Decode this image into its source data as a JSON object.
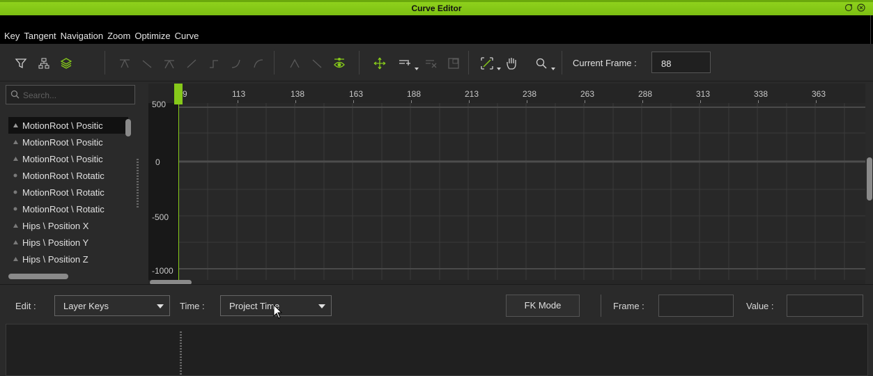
{
  "window": {
    "title": "Curve Editor",
    "restore_icon": "restore-icon",
    "close_icon": "close-icon"
  },
  "menu": [
    "Key",
    "Tangent",
    "Navigation",
    "Zoom",
    "Optimize",
    "Curve"
  ],
  "toolbar": {
    "current_frame_label": "Current Frame :",
    "current_frame_value": "88",
    "icons": [
      "filter-curve-icon",
      "hierarchy-icon",
      "layers-icon",
      "flatten-tangent-icon",
      "linear-tangent-icon",
      "smooth-tangent-icon",
      "step-tangent-icon",
      "step-out-icon",
      "ease-in-icon",
      "ease-out-icon",
      "break-tangent-icon",
      "unify-tangent-icon",
      "show-tangents-icon",
      "move-icon",
      "add-key-icon",
      "delete-key-icon",
      "fit-icon",
      "zoom-extent-icon",
      "pan-hand-icon",
      "zoom-icon"
    ],
    "accent": "#86c91a"
  },
  "search": {
    "placeholder": "Search..."
  },
  "curve_list": [
    {
      "label": "MotionRoot \\ Positic",
      "marker": "triangle",
      "selected": true
    },
    {
      "label": "MotionRoot \\ Positic",
      "marker": "triangle"
    },
    {
      "label": "MotionRoot \\ Positic",
      "marker": "triangle"
    },
    {
      "label": "MotionRoot \\ Rotatic",
      "marker": "dot"
    },
    {
      "label": "MotionRoot \\ Rotatic",
      "marker": "dot"
    },
    {
      "label": "MotionRoot \\ Rotatic",
      "marker": "dot"
    },
    {
      "label": "Hips \\ Position X",
      "marker": "triangle"
    },
    {
      "label": "Hips \\ Position Y",
      "marker": "triangle"
    },
    {
      "label": "Hips \\ Position Z",
      "marker": "triangle"
    }
  ],
  "graph": {
    "time_ticks": [
      "9",
      "113",
      "138",
      "163",
      "188",
      "213",
      "238",
      "263",
      "288",
      "313",
      "338",
      "363"
    ],
    "value_ticks": [
      "500",
      "0",
      "-500",
      "-1000"
    ],
    "current_frame_marker": "88"
  },
  "bottom": {
    "edit_label": "Edit :",
    "edit_value": "Layer Keys",
    "time_label": "Time :",
    "time_value": "Project Time",
    "fk_mode_label": "FK Mode",
    "frame_label": "Frame :",
    "frame_value": "",
    "value_label": "Value :",
    "value_value": ""
  }
}
